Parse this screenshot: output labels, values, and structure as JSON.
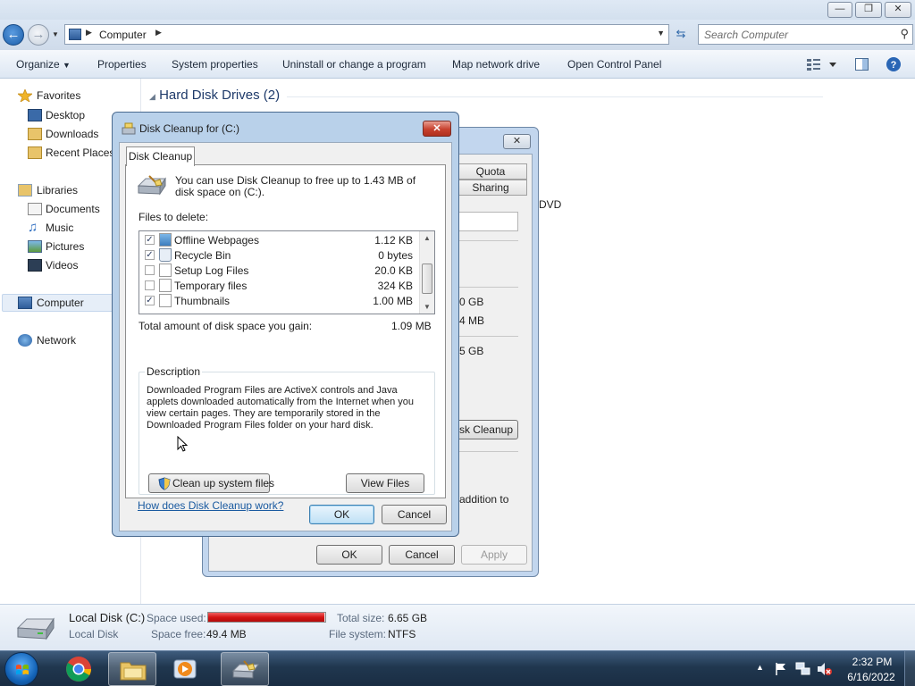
{
  "explorer": {
    "address": {
      "crumb": "Computer"
    },
    "search": {
      "placeholder": "Search Computer"
    },
    "toolbar": {
      "organize": "Organize",
      "properties": "Properties",
      "system_properties": "System properties",
      "uninstall": "Uninstall or change a program",
      "map_drive": "Map network drive",
      "control_panel": "Open Control Panel"
    },
    "nav": {
      "favorites": "Favorites",
      "desktop": "Desktop",
      "downloads": "Downloads",
      "recent": "Recent Places",
      "libraries": "Libraries",
      "documents": "Documents",
      "music": "Music",
      "pictures": "Pictures",
      "videos": "Videos",
      "computer": "Computer",
      "network": "Network"
    },
    "content": {
      "group_header": "Hard Disk Drives (2)",
      "dvd": "DVD"
    },
    "details": {
      "name": "Local Disk (C:)",
      "type": "Local Disk",
      "space_used_label": "Space used:",
      "space_free_label": "Space free:",
      "space_free": "49.4 MB",
      "total_size_label": "Total size:",
      "total_size": "6.65 GB",
      "filesystem_label": "File system:",
      "filesystem": "NTFS",
      "used_fraction": 0.99
    }
  },
  "properties_dialog": {
    "tabs": [
      "Quota",
      "Sharing"
    ],
    "values": [
      "0 GB",
      "4 MB",
      "5 GB"
    ],
    "cleanup_button": "sk Cleanup",
    "fragment": "addition to",
    "ok": "OK",
    "cancel": "Cancel",
    "apply": "Apply"
  },
  "cleanup_dialog": {
    "title": "Disk Cleanup for  (C:)",
    "tab": "Disk Cleanup",
    "intro": "You can use Disk Cleanup to free up to 1.43 MB of disk space on  (C:).",
    "files_label": "Files to delete:",
    "files": [
      {
        "name": "Offline Webpages",
        "size": "1.12 KB",
        "checked": true
      },
      {
        "name": "Recycle Bin",
        "size": "0 bytes",
        "checked": true
      },
      {
        "name": "Setup Log Files",
        "size": "20.0 KB",
        "checked": false
      },
      {
        "name": "Temporary files",
        "size": "324 KB",
        "checked": false
      },
      {
        "name": "Thumbnails",
        "size": "1.00 MB",
        "checked": true
      }
    ],
    "total_label": "Total amount of disk space you gain:",
    "total_value": "1.09 MB",
    "description_legend": "Description",
    "description": "Downloaded Program Files are ActiveX controls and Java applets downloaded automatically from the Internet when you view certain pages. They are temporarily stored in the Downloaded Program Files folder on your hard disk.",
    "cleanup_system": "Clean up system files",
    "view_files": "View Files",
    "help_link": "How does Disk Cleanup work?",
    "ok": "OK",
    "cancel": "Cancel"
  },
  "taskbar": {
    "time": "2:32 PM",
    "date": "6/16/2022"
  },
  "colors": {
    "usage_bar": "#d41515",
    "link": "#1a5aa0",
    "taskbar": "#20374f"
  }
}
